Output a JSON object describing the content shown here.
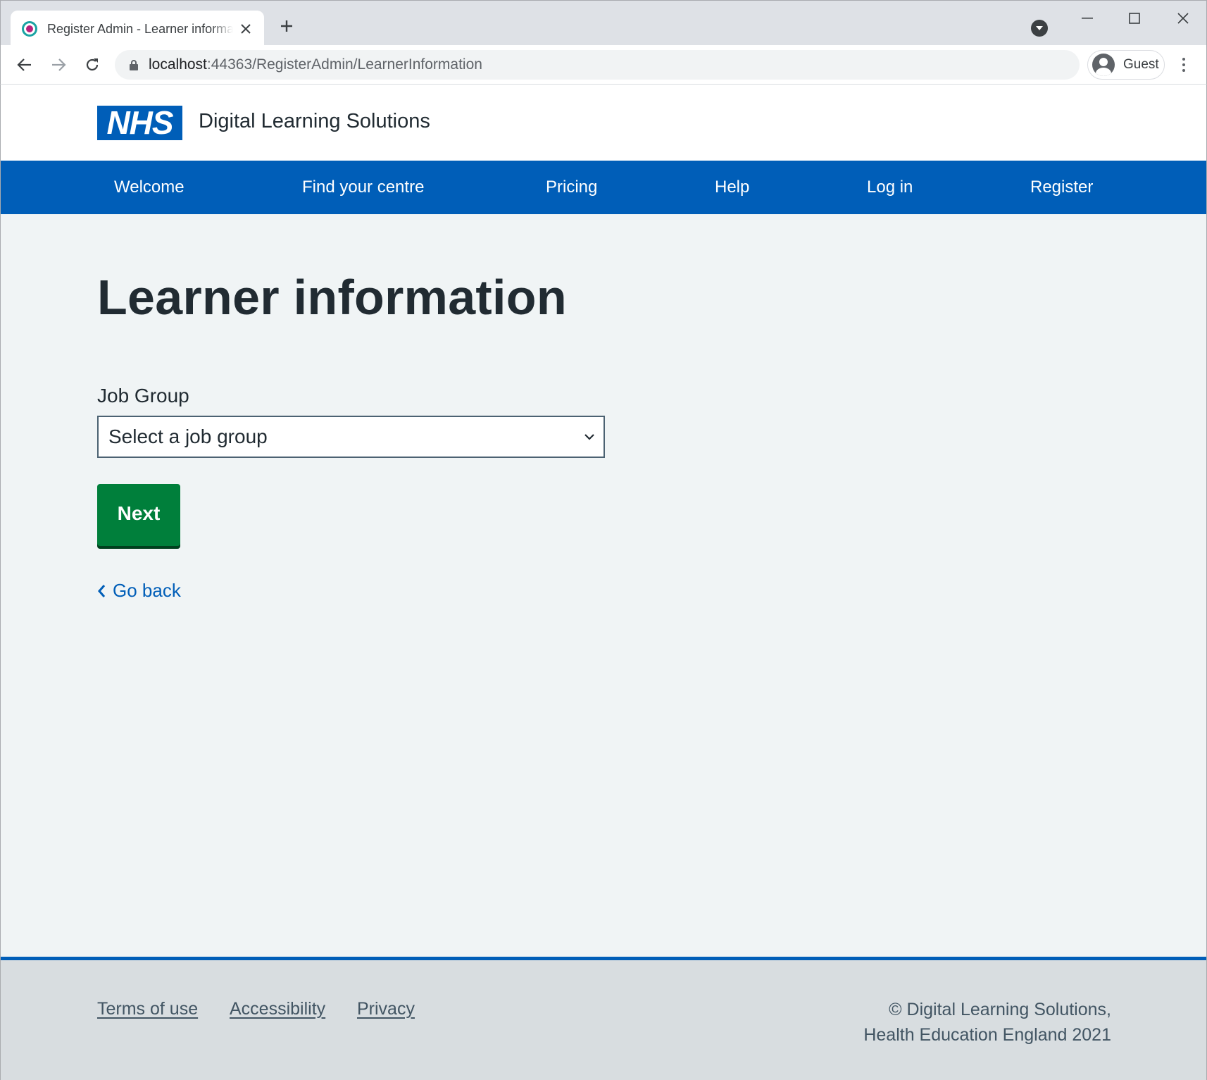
{
  "browser": {
    "tab_title": "Register Admin - Learner information",
    "url_host": "localhost",
    "url_rest": ":44363/RegisterAdmin/LearnerInformation",
    "profile_label": "Guest"
  },
  "header": {
    "logo_text": "NHS",
    "service_name": "Digital Learning Solutions"
  },
  "nav": {
    "items": [
      {
        "label": "Welcome"
      },
      {
        "label": "Find your centre"
      },
      {
        "label": "Pricing"
      },
      {
        "label": "Help"
      },
      {
        "label": "Log in"
      },
      {
        "label": "Register"
      }
    ]
  },
  "main": {
    "title": "Learner information",
    "job_group": {
      "label": "Job Group",
      "selected": "Select a job group"
    },
    "next_label": "Next",
    "back_label": "Go back"
  },
  "footer": {
    "links": [
      {
        "label": "Terms of use"
      },
      {
        "label": "Accessibility"
      },
      {
        "label": "Privacy"
      }
    ],
    "copyright_line1": "© Digital Learning Solutions,",
    "copyright_line2": "Health Education England 2021"
  },
  "colors": {
    "nhs_blue": "#005eb8",
    "button_green": "#007f3b",
    "page_bg": "#f0f4f5",
    "footer_bg": "#d8dde0",
    "text_dark": "#212b32"
  }
}
